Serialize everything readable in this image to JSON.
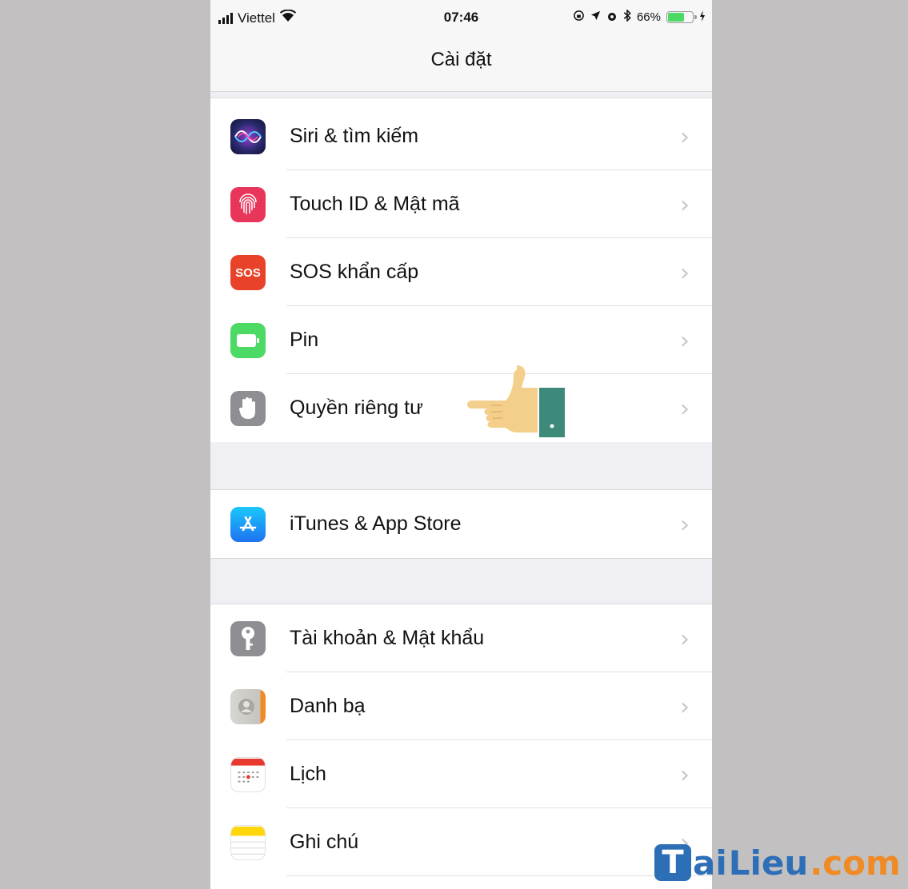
{
  "status_bar": {
    "carrier": "Viettel",
    "time": "07:46",
    "battery_percent_label": "66%",
    "battery_level": 0.66,
    "icons": [
      "signal-icon",
      "wifi-icon",
      "rotation-lock-icon",
      "location-icon",
      "alarm-icon",
      "bluetooth-icon",
      "battery-icon",
      "charging-icon"
    ]
  },
  "nav": {
    "title": "Cài đặt"
  },
  "groups": [
    {
      "items": [
        {
          "label": "Siri & tìm kiếm",
          "icon": "siri-icon",
          "icon_color": "#3b3f9c"
        },
        {
          "label": "Touch ID & Mật mã",
          "icon": "fingerprint-icon",
          "icon_color": "#e8365b"
        },
        {
          "label": "SOS khẩn cấp",
          "icon": "sos-icon",
          "icon_text": "SOS",
          "icon_color": "#e8432a"
        },
        {
          "label": "Pin",
          "icon": "battery-app-icon",
          "icon_color": "#4cd964"
        },
        {
          "label": "Quyền riêng tư",
          "icon": "privacy-hand-icon",
          "icon_color": "#8e8e93"
        }
      ]
    },
    {
      "items": [
        {
          "label": "iTunes & App Store",
          "icon": "app-store-icon",
          "icon_color": "#1e8ef5"
        }
      ]
    },
    {
      "items": [
        {
          "label": "Tài khoản & Mật khẩu",
          "icon": "key-icon",
          "icon_color": "#8e8e93"
        },
        {
          "label": "Danh bạ",
          "icon": "contacts-icon",
          "icon_color": "#c8c6c2"
        },
        {
          "label": "Lịch",
          "icon": "calendar-icon",
          "icon_color": "#ffffff"
        },
        {
          "label": "Ghi chú",
          "icon": "notes-icon",
          "icon_color": "#ffd60a"
        }
      ]
    }
  ],
  "chevron": "›",
  "watermark": {
    "letter": "T",
    "part1": "ai",
    "part2": "Lieu",
    "part3": ".com"
  }
}
